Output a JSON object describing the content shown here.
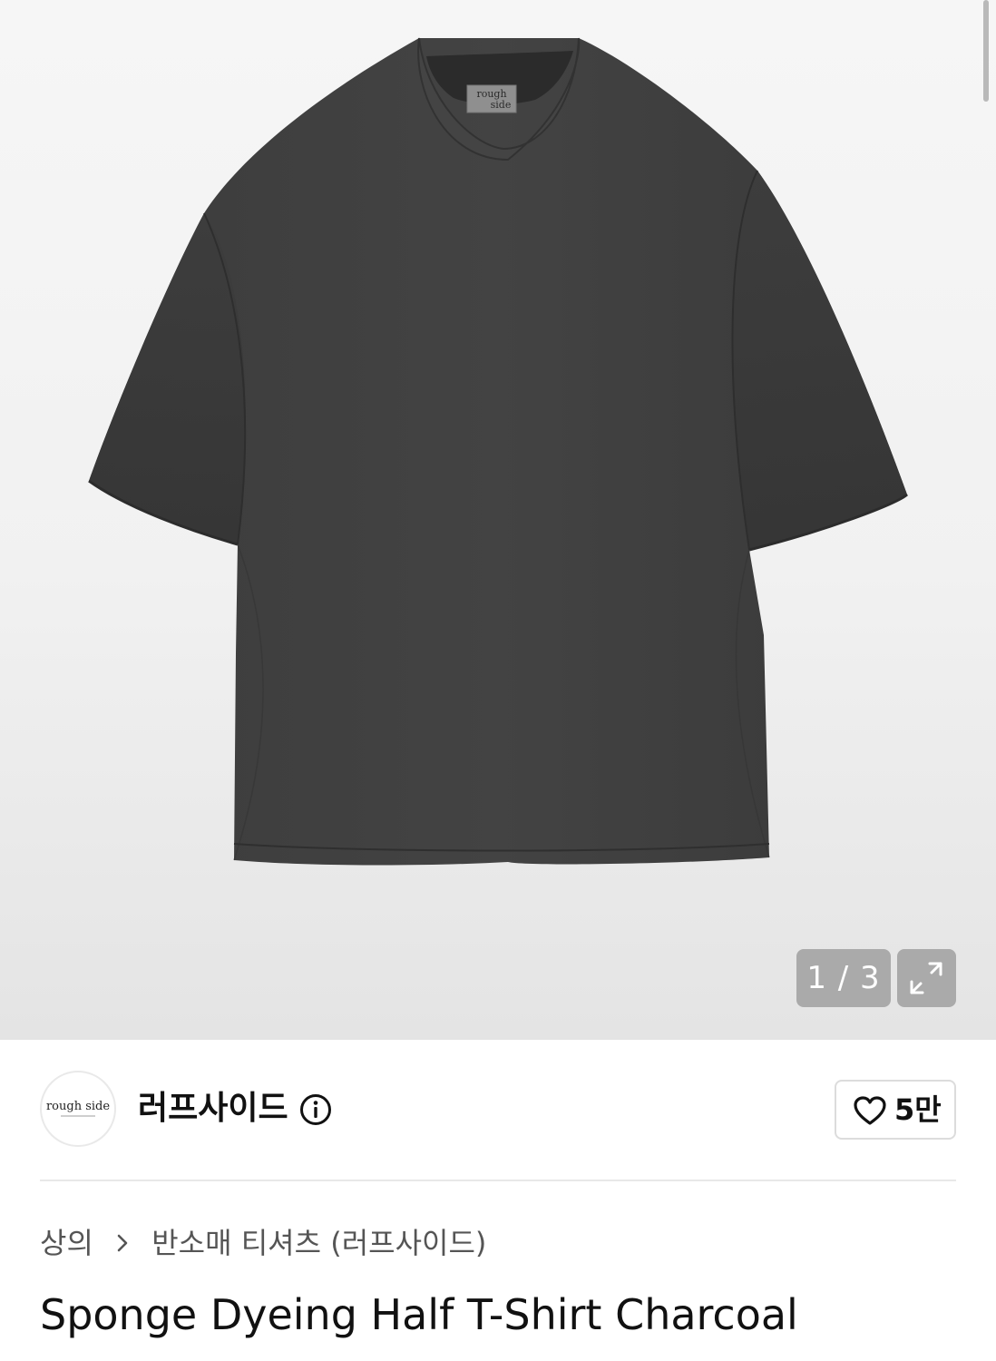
{
  "gallery": {
    "current": "1",
    "separator": "/",
    "total": "3",
    "counter_text": "1 / 3",
    "expand_icon": "expand-arrows-icon",
    "product_image": "charcoal-t-shirt-photo",
    "neck_label_line1": "rough",
    "neck_label_line2": "side"
  },
  "brand": {
    "logo_text": "rough side",
    "name": "러프사이드",
    "info_icon": "info-circle-icon"
  },
  "like": {
    "icon": "heart-icon",
    "count": "5만"
  },
  "breadcrumb": {
    "category": "상의",
    "separator_icon": "chevron-right-icon",
    "subcategory": "반소매 티셔츠 (러프사이드)"
  },
  "product": {
    "title": "Sponge Dyeing Half T-Shirt Charcoal"
  },
  "colors": {
    "shirt": "#3a3a3a",
    "overlay": "#969696",
    "text_primary": "#111111",
    "text_secondary": "#555555",
    "border": "#dcdcdc"
  }
}
